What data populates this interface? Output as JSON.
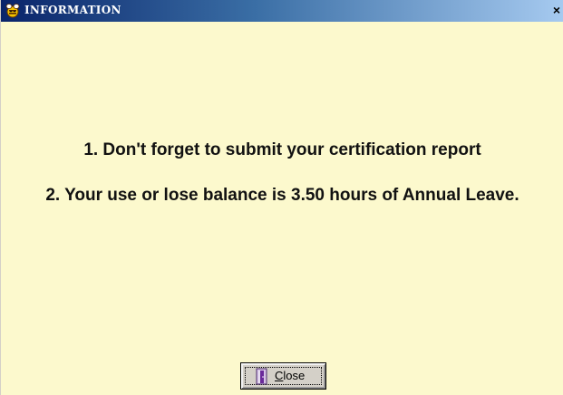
{
  "window": {
    "title": "INFORMATION",
    "close_glyph": "×",
    "title_icon": "bee-icon",
    "close_icon": "close-icon"
  },
  "messages": [
    "1. Don't forget to submit your certification report",
    "2. Your use or lose balance is 3.50 hours of Annual Leave."
  ],
  "close_button": {
    "mnemonic": "C",
    "rest": "lose",
    "icon": "door-exit-icon"
  },
  "colors": {
    "background": "#fcf9cd",
    "titlebar_start": "#0a246a",
    "titlebar_end": "#a6caf0",
    "text": "#111111",
    "button_face": "#d4d0c8"
  }
}
